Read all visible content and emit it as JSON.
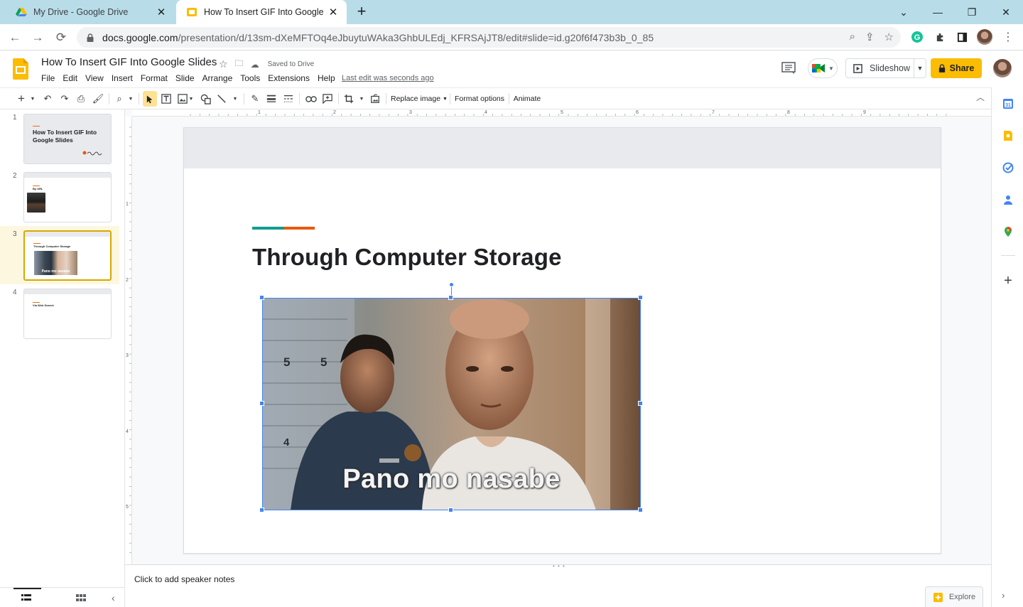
{
  "browser": {
    "tabs": [
      {
        "title": "My Drive - Google Drive",
        "icon": "google-drive-icon",
        "active": false
      },
      {
        "title": "How To Insert GIF Into Google Sli",
        "icon": "google-slides-icon",
        "active": true
      }
    ],
    "new_tab": "+",
    "url_host": "docs.google.com",
    "url_path": "/presentation/d/13sm-dXeMFTOq4eJbuytuWAka3GhbULEdj_KFRSAjJT8/edit#slide=id.g20f6f473b3b_0_85"
  },
  "app": {
    "doc_title": "How To Insert GIF Into Google Slides",
    "saved_status": "Saved to Drive",
    "menu": [
      "File",
      "Edit",
      "View",
      "Insert",
      "Format",
      "Slide",
      "Arrange",
      "Tools",
      "Extensions",
      "Help"
    ],
    "last_edit": "Last edit was seconds ago",
    "slideshow_label": "Slideshow",
    "share_label": "Share",
    "accent_color": "#fbbc04"
  },
  "toolbar": {
    "replace_image": "Replace image",
    "format_options": "Format options",
    "animate": "Animate"
  },
  "ruler": {
    "h_numbers": [
      "1",
      "1",
      "2",
      "3",
      "4",
      "5",
      "6",
      "7",
      "8",
      "9"
    ],
    "v_numbers": [
      "1",
      "2",
      "3",
      "4",
      "5"
    ]
  },
  "filmstrip": [
    {
      "number": "1",
      "title": "How To Insert GIF Into Google Slides",
      "selected": false
    },
    {
      "number": "2",
      "title": "By URL",
      "selected": false
    },
    {
      "number": "3",
      "title": "Through Computer Storage",
      "selected": true,
      "thumb_caption": "Pano mo nasabe"
    },
    {
      "number": "4",
      "title": "Via Web Search",
      "selected": false
    }
  ],
  "slide": {
    "title": "Through Computer Storage",
    "gif_caption": "Pano mo nasabe",
    "gif_scale_marks": [
      "5",
      "5",
      "4"
    ],
    "accent_teal": "#0f9d8e",
    "accent_orange": "#e8590c",
    "selection_color": "#4285f4"
  },
  "notes": {
    "placeholder": "Click to add speaker notes"
  },
  "explore_label": "Explore"
}
